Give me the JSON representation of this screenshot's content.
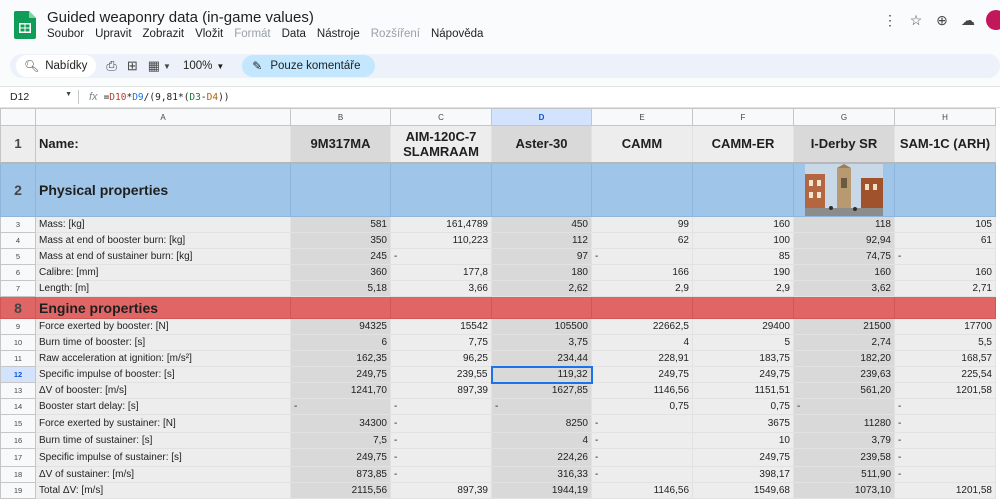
{
  "title": "Guided weaponry data (in-game values)",
  "menu": [
    "Soubor",
    "Upravit",
    "Zobrazit",
    "Vložit",
    "Formát",
    "Data",
    "Nástroje",
    "Rozšíření",
    "Nápověda"
  ],
  "menu_disabled": [
    "Formát",
    "Rozšíření"
  ],
  "toolbar": {
    "search_label": "Nabídky",
    "zoom": "100%",
    "comment_mode": "Pouze komentáře"
  },
  "formula_bar": {
    "cell_ref": "D12",
    "fx": "fx",
    "formula": "=D10*D9/(9,81*(D3-D4))"
  },
  "columns": [
    "A",
    "B",
    "C",
    "D",
    "E",
    "F",
    "G",
    "H"
  ],
  "selected_column": "D",
  "selected_row": 12,
  "active_cell": "D12",
  "header_row": {
    "label": "Name:",
    "names": [
      "9M317MA",
      "AIM-120C-7 SLAMRAAM",
      "Aster-30",
      "CAMM",
      "CAMM-ER",
      "I-Derby SR",
      "SAM-1C (ARH)"
    ]
  },
  "sections": {
    "physical": "Physical properties",
    "engine": "Engine properties"
  },
  "section_colors": {
    "physical": "#9fc5e8",
    "engine": "#e06666"
  },
  "rows": [
    {
      "n": 3,
      "label": "Mass: [kg]",
      "vals": [
        "581",
        "161,4789",
        "450",
        "99",
        "160",
        "118",
        "105"
      ]
    },
    {
      "n": 4,
      "label": "Mass at end of booster burn: [kg]",
      "vals": [
        "350",
        "110,223",
        "112",
        "62",
        "100",
        "92,94",
        "61"
      ]
    },
    {
      "n": 5,
      "label": "Mass at end of sustainer burn: [kg]",
      "vals": [
        "245",
        "-",
        "97",
        "-",
        "85",
        "74,75",
        "-"
      ]
    },
    {
      "n": 6,
      "label": "Calibre: [mm]",
      "vals": [
        "360",
        "177,8",
        "180",
        "166",
        "190",
        "160",
        "160"
      ]
    },
    {
      "n": 7,
      "label": "Length: [m]",
      "vals": [
        "5,18",
        "3,66",
        "2,62",
        "2,9",
        "2,9",
        "3,62",
        "2,71"
      ]
    },
    {
      "n": 9,
      "label": "Force exerted by booster: [N]",
      "vals": [
        "94325",
        "15542",
        "105500",
        "22662,5",
        "29400",
        "21500",
        "17700"
      ]
    },
    {
      "n": 10,
      "label": "Burn time of booster: [s]",
      "vals": [
        "6",
        "7,75",
        "3,75",
        "4",
        "5",
        "2,74",
        "5,5"
      ]
    },
    {
      "n": 11,
      "label": "Raw acceleration at ignition: [m/s²]",
      "vals": [
        "162,35",
        "96,25",
        "234,44",
        "228,91",
        "183,75",
        "182,20",
        "168,57"
      ]
    },
    {
      "n": 12,
      "label": "Specific impulse of booster: [s]",
      "vals": [
        "249,75",
        "239,55",
        "119,32",
        "249,75",
        "249,75",
        "239,63",
        "225,54"
      ]
    },
    {
      "n": 13,
      "label": "ΔV of booster: [m/s]",
      "vals": [
        "1241,70",
        "897,39",
        "1627,85",
        "1146,56",
        "1151,51",
        "561,20",
        "1201,58"
      ]
    },
    {
      "n": 14,
      "label": "Booster start delay: [s]",
      "vals": [
        "-",
        "-",
        "-",
        "0,75",
        "0,75",
        "-",
        "-"
      ]
    },
    {
      "n": 15,
      "label": "Force exerted by sustainer: [N]",
      "vals": [
        "34300",
        "-",
        "8250",
        "-",
        "3675",
        "11280",
        "-"
      ]
    },
    {
      "n": 16,
      "label": "Burn time of sustainer: [s]",
      "vals": [
        "7,5",
        "-",
        "4",
        "-",
        "10",
        "3,79",
        "-"
      ]
    },
    {
      "n": 17,
      "label": "Specific impulse of sustainer: [s]",
      "vals": [
        "249,75",
        "-",
        "224,26",
        "-",
        "249,75",
        "239,58",
        "-"
      ]
    },
    {
      "n": 18,
      "label": "ΔV of sustainer: [m/s]",
      "vals": [
        "873,85",
        "-",
        "316,33",
        "-",
        "398,17",
        "511,90",
        "-"
      ]
    },
    {
      "n": 19,
      "label": "Total ΔV: [m/s]",
      "vals": [
        "2115,56",
        "897,39",
        "1944,19",
        "1146,56",
        "1549,68",
        "1073,10",
        "1201,58"
      ]
    }
  ]
}
